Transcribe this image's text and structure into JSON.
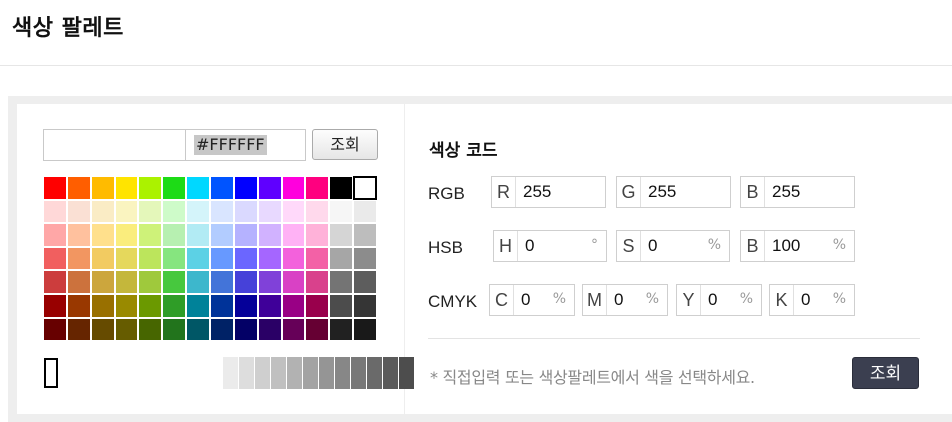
{
  "page": {
    "title": "색상 팔레트"
  },
  "picker": {
    "hex_value": "#FFFFFF",
    "lookup_label": "조회"
  },
  "palette": {
    "rows": [
      [
        "#ff0000",
        "#ff5e00",
        "#ffbb00",
        "#ffe400",
        "#abf200",
        "#1ddb16",
        "#00d8ff",
        "#0054ff",
        "#0100ff",
        "#5f00ff",
        "#ff00dd",
        "#ff007f",
        "#000000",
        "#ffffff"
      ],
      [
        "#ffd8d8",
        "#fae0d4",
        "#faecc5",
        "#faf4c0",
        "#e4f7ba",
        "#cefbc9",
        "#d4f4fa",
        "#d9e5ff",
        "#dad9ff",
        "#e8d9ff",
        "#ffd9fa",
        "#ffd9ec",
        "#f6f6f6",
        "#eaeaea"
      ],
      [
        "#ffa7a7",
        "#ffc19e",
        "#ffe08c",
        "#faed7d",
        "#cef279",
        "#b7f0b1",
        "#b2ebf4",
        "#b2ccff",
        "#b5b2ff",
        "#d1b2ff",
        "#ffb2f5",
        "#ffb2d9",
        "#d5d5d5",
        "#bdbdbd"
      ],
      [
        "#f15f5f",
        "#f29661",
        "#f2cb61",
        "#e5d85c",
        "#bce55c",
        "#86e57f",
        "#5cd1e5",
        "#6799ff",
        "#6b66ff",
        "#a566ff",
        "#f361dc",
        "#f361a6",
        "#a6a6a6",
        "#8c8c8c"
      ],
      [
        "#cc3d3d",
        "#cc723d",
        "#cca63d",
        "#c4b73b",
        "#9fc93c",
        "#47c83e",
        "#3db7cc",
        "#4374d9",
        "#4641d9",
        "#8041d9",
        "#d941c5",
        "#d9418c",
        "#747474",
        "#5d5d5d"
      ],
      [
        "#980000",
        "#993800",
        "#997000",
        "#998a00",
        "#6b9900",
        "#2f9d27",
        "#008299",
        "#003399",
        "#050099",
        "#3f0099",
        "#990085",
        "#99004c",
        "#4c4c4c",
        "#353535"
      ],
      [
        "#670000",
        "#662500",
        "#664b00",
        "#665c00",
        "#476600",
        "#22741c",
        "#005766",
        "#002266",
        "#030066",
        "#2a0066",
        "#660058",
        "#660033",
        "#212121",
        "#191919"
      ]
    ],
    "grays": [
      "#ebebeb",
      "#dddddd",
      "#cfcfcf",
      "#c0c0c0",
      "#b2b2b2",
      "#a3a3a3",
      "#959595",
      "#878787",
      "#787878",
      "#6a6a6a",
      "#5b5b5b",
      "#4d4d4d"
    ]
  },
  "codes": {
    "title": "색상 코드",
    "rgb": {
      "label": "RGB",
      "r_tag": "R",
      "r": "255",
      "g_tag": "G",
      "g": "255",
      "b_tag": "B",
      "b": "255"
    },
    "hsb": {
      "label": "HSB",
      "h_tag": "H",
      "h": "0",
      "h_unit": "°",
      "s_tag": "S",
      "s": "0",
      "s_unit": "%",
      "b_tag": "B",
      "b": "100",
      "b_unit": "%"
    },
    "cmyk": {
      "label": "CMYK",
      "c_tag": "C",
      "c": "0",
      "m_tag": "M",
      "m": "0",
      "y_tag": "Y",
      "y": "0",
      "k_tag": "K",
      "k": "0",
      "unit": "%"
    }
  },
  "footer": {
    "hint": "* 직접입력 또는 색상팔레트에서 색을 선택하세요.",
    "lookup_label": "조회"
  }
}
